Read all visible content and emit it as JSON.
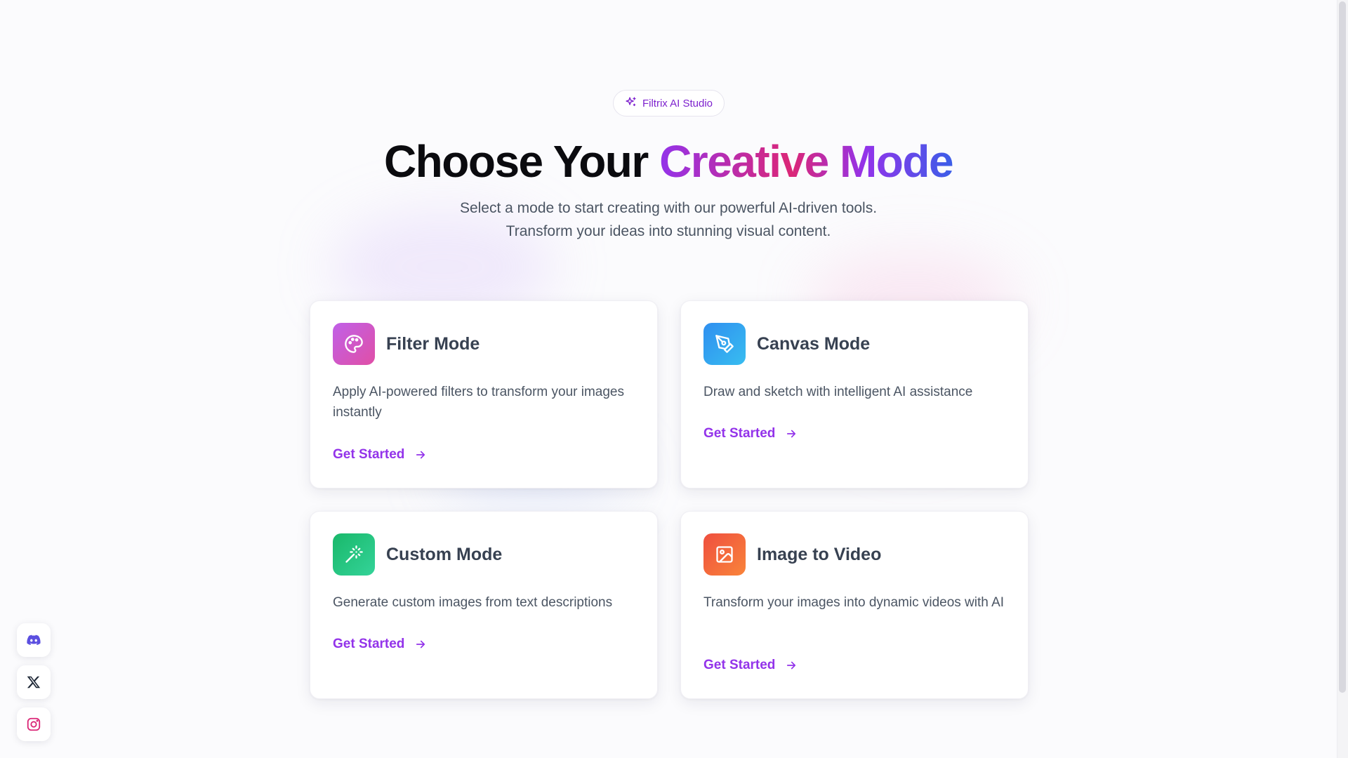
{
  "badge": {
    "label": "Filtrix AI Studio",
    "icon": "sparkles-icon"
  },
  "hero": {
    "title_plain": "Choose Your ",
    "title_gradient": "Creative Mode",
    "subtitle_line1": "Select a mode to start creating with our powerful AI-driven tools.",
    "subtitle_line2": "Transform your ideas into stunning visual content."
  },
  "cards": [
    {
      "title": "Filter Mode",
      "description": "Apply AI-powered filters to transform your images instantly",
      "cta": "Get Started",
      "icon": "palette-icon"
    },
    {
      "title": "Canvas Mode",
      "description": "Draw and sketch with intelligent AI assistance",
      "cta": "Get Started",
      "icon": "pen-tool-icon"
    },
    {
      "title": "Custom Mode",
      "description": "Generate custom images from text descriptions",
      "cta": "Get Started",
      "icon": "magic-wand-icon"
    },
    {
      "title": "Image to Video",
      "description": "Transform your images into dynamic videos with AI",
      "cta": "Get Started",
      "icon": "image-icon"
    }
  ],
  "social": [
    {
      "icon": "discord-icon",
      "color": "#5b4fe0"
    },
    {
      "icon": "x-icon",
      "color": "#1f2937"
    },
    {
      "icon": "instagram-icon",
      "color": "#db2777"
    }
  ],
  "colors": {
    "accent": "#9333ea",
    "gradient_start": "#9333ea",
    "gradient_mid": "#db2777",
    "gradient_end": "#3b5ee8"
  }
}
